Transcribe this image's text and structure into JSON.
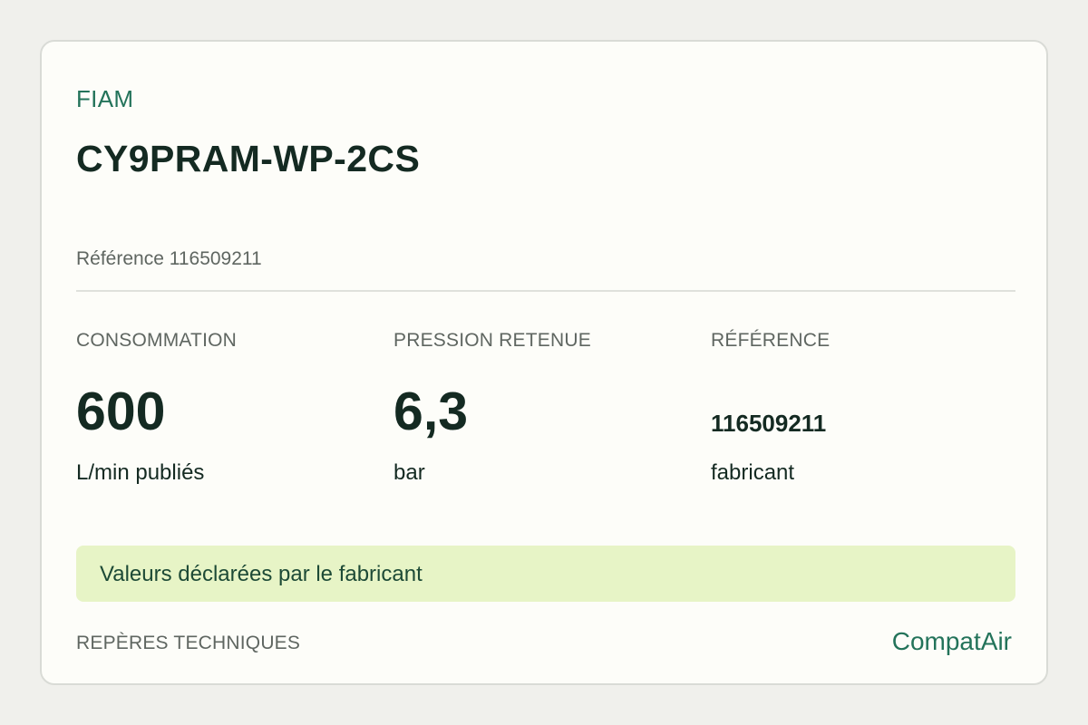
{
  "product": {
    "brand": "FIAM",
    "model": "CY9PRAM-WP-2CS",
    "reference_line": "Référence 116509211"
  },
  "metrics": [
    {
      "label": "CONSOMMATION",
      "value": "600",
      "unit": "L/min publiés"
    },
    {
      "label": "PRESSION RETENUE",
      "value": "6,3",
      "unit": "bar"
    },
    {
      "label": "RÉFÉRENCE",
      "value": "116509211",
      "unit": "fabricant"
    }
  ],
  "notice": {
    "text": "Valeurs déclarées par le fabricant"
  },
  "footer": {
    "label": "REPÈRES TECHNIQUES",
    "brand": "CompatAir"
  },
  "colors": {
    "accent": "#23735a",
    "notice_bg": "#e7f4c6",
    "page_bg": "#f0f0ec",
    "card_bg": "#fdfdf9"
  }
}
